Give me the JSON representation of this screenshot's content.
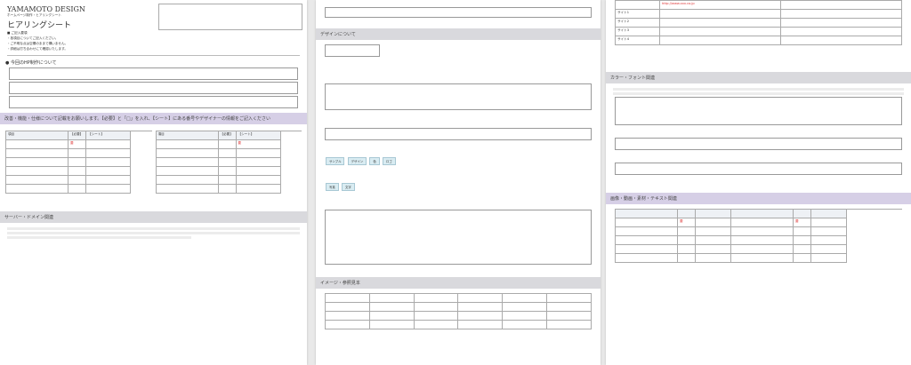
{
  "p1": {
    "brand": "YAMAMOTO DESIGN",
    "sub": "ホームページ制作・ヒアリングシート",
    "title": "ヒアリングシート",
    "notes_title": "■ ご記入要項",
    "notes": [
      "・各項目についてご記入ください。",
      "・ご不明な点は空欄のままで構いません。",
      "・詳細は打ち合わせにて確認いたします。"
    ],
    "sec1": "今回のHP制作について",
    "sec2": "改善・機能・仕様について記載をお願いします。【必要】と「□」を入れ、【シート】にある番号やデザイナーの情報をご記入ください",
    "sec3": "サーバー・ドメイン関連",
    "t1": [
      "項目",
      "【必要】",
      "【シート】"
    ],
    "t2": [
      "項目",
      "【必要】",
      "【シート】"
    ],
    "red": "要"
  },
  "p2": {
    "sec1": "デザインについて",
    "sec2": "イメージ・参照見本",
    "pills": [
      "サンプル",
      "デザイン",
      "色",
      "ロゴ",
      "写真",
      "文字"
    ]
  },
  "p3": {
    "sec1": "カラー・フォント関連",
    "sec2": "画像・動画・素材・テキスト関連",
    "url": "http://www.xxx.co.jp",
    "rows": [
      "サイト1",
      "サイト2",
      "サイト3",
      "サイト4"
    ],
    "red": "要"
  }
}
